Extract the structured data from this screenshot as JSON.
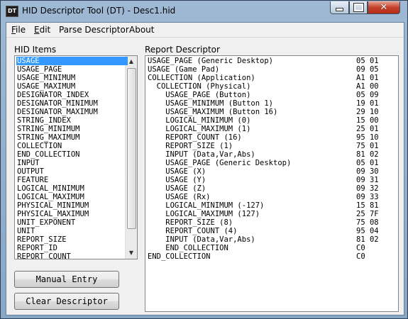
{
  "window": {
    "title": "HID Descriptor Tool (DT) - Desc1.hid",
    "icon_text": "DT"
  },
  "menu": {
    "items": [
      {
        "label": "File",
        "accel": "F",
        "rest": "ile"
      },
      {
        "label": "Edit",
        "accel": "E",
        "rest": "dit"
      },
      {
        "label": "Parse Descriptor"
      },
      {
        "label": "About"
      }
    ]
  },
  "hid_items": {
    "label": "HID Items",
    "items": [
      "USAGE",
      "USAGE_PAGE",
      "USAGE_MINIMUM",
      "USAGE_MAXIMUM",
      "DESIGNATOR_INDEX",
      "DESIGNATOR_MINIMUM",
      "DESIGNATOR_MAXIMUM",
      "STRING_INDEX",
      "STRING_MINIMUM",
      "STRING_MAXIMUM",
      "COLLECTION",
      "END_COLLECTION",
      "INPUT",
      "OUTPUT",
      "FEATURE",
      "LOGICAL_MINIMUM",
      "LOGICAL_MAXIMUM",
      "PHYSICAL_MINIMUM",
      "PHYSICAL_MAXIMUM",
      "UNIT_EXPONENT",
      "UNIT",
      "REPORT_SIZE",
      "REPORT_ID",
      "REPORT_COUNT"
    ],
    "selected": "USAGE"
  },
  "buttons": {
    "manual_entry": "Manual Entry",
    "clear_descriptor": "Clear Descriptor"
  },
  "report_descriptor": {
    "label": "Report Descriptor",
    "rows": [
      {
        "text": "USAGE_PAGE (Generic Desktop)",
        "code": "05 01"
      },
      {
        "text": "USAGE (Game Pad)",
        "code": "09 05"
      },
      {
        "text": "COLLECTION (Application)",
        "code": "A1 01"
      },
      {
        "text": "  COLLECTION (Physical)",
        "code": "A1 00"
      },
      {
        "text": "    USAGE_PAGE (Button)",
        "code": "05 09"
      },
      {
        "text": "    USAGE_MINIMUM (Button 1)",
        "code": "19 01"
      },
      {
        "text": "    USAGE_MAXIMUM (Button 16)",
        "code": "29 10"
      },
      {
        "text": "    LOGICAL_MINIMUM (0)",
        "code": "15 00"
      },
      {
        "text": "    LOGICAL_MAXIMUM (1)",
        "code": "25 01"
      },
      {
        "text": "    REPORT_COUNT (16)",
        "code": "95 10"
      },
      {
        "text": "    REPORT_SIZE (1)",
        "code": "75 01"
      },
      {
        "text": "    INPUT (Data,Var,Abs)",
        "code": "81 02"
      },
      {
        "text": "    USAGE_PAGE (Generic Desktop)",
        "code": "05 01"
      },
      {
        "text": "    USAGE (X)",
        "code": "09 30"
      },
      {
        "text": "    USAGE (Y)",
        "code": "09 31"
      },
      {
        "text": "    USAGE (Z)",
        "code": "09 32"
      },
      {
        "text": "    USAGE (Rx)",
        "code": "09 33"
      },
      {
        "text": "    LOGICAL_MINIMUM (-127)",
        "code": "15 81"
      },
      {
        "text": "    LOGICAL_MAXIMUM (127)",
        "code": "25 7F"
      },
      {
        "text": "    REPORT_SIZE (8)",
        "code": "75 08"
      },
      {
        "text": "    REPORT_COUNT (4)",
        "code": "95 04"
      },
      {
        "text": "    INPUT (Data,Var,Abs)",
        "code": "81 02"
      },
      {
        "text": "    END_COLLECTION",
        "code": "C0"
      },
      {
        "text": "END_COLLECTION",
        "code": "C0"
      }
    ]
  },
  "colors": {
    "selection": "#3399ff",
    "close_button": "#c5412a",
    "frame": "#9fb9d4"
  },
  "icons": {
    "minimize": "minimize-icon",
    "maximize": "maximize-icon",
    "close": "close-icon",
    "scroll_up": "scroll-up-arrow-icon",
    "scroll_down": "scroll-down-arrow-icon"
  }
}
